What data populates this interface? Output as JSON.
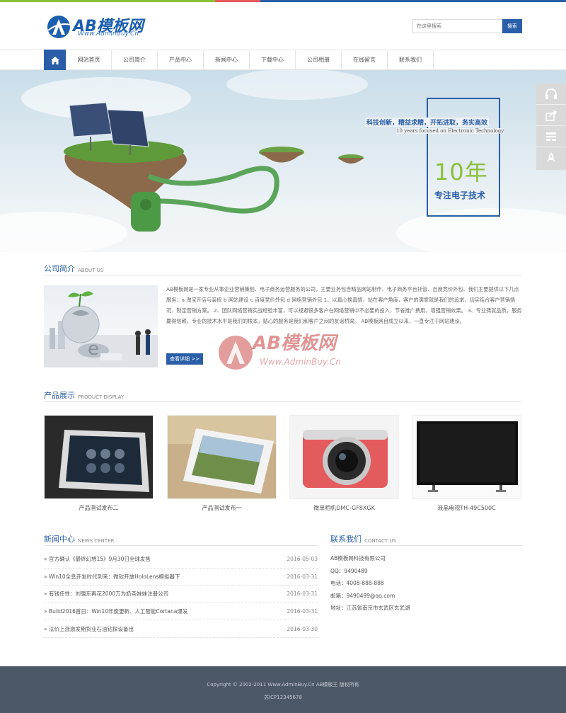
{
  "colors": {
    "primary": "#2a5ea8",
    "accent_green": "#8bbf3a",
    "topbar": [
      "#8bbf3a",
      "#e65a5a",
      "#2a5ea8"
    ],
    "footer_bg": "#4d5867"
  },
  "header": {
    "logo_text": "AB模板网",
    "logo_sub": "Www.AdminBuy.Cn",
    "search_placeholder": "在这里搜索",
    "search_button": "搜索"
  },
  "nav": {
    "home_icon": "home-icon",
    "items": [
      "网站首页",
      "公司简介",
      "产品中心",
      "新闻中心",
      "下载中心",
      "公司相册",
      "在线留言",
      "联系我们"
    ]
  },
  "banner": {
    "slogan": "科技创新，精益求精，开拓进取，务实高效",
    "sub": "10 years focused on Electronic Technology",
    "years": "10年",
    "tagline": "专注电子技术"
  },
  "side_tools": [
    "headset-icon",
    "share-icon",
    "qrcode-icon",
    "rocket-icon"
  ],
  "about": {
    "title": "公司简介",
    "title_en": "ABOUT US",
    "text": "AB模板网是一家专业从事企业营销策划、电子商务运营服务的公司，主要业务包含精品网站制作、电子商务平台托管、百度竞价外包、我们主要提供以下几点服务：a 淘宝开店与装修 b 网站建设 c 百度竞价外包 d 网络营销外包 1、以真心换真情，站在客户角度，客户的满意就是我们的追求，切实结合客户营销情况，制定营销方案。 2、团队网络营销实战经验丰富，可以规避很多客户在网络营销中不必要的投入，节省推广费用，增强营销效果。 3、专业铸就品质，服务赢得信赖，专业的技术水平是我们的根本，贴心的服务是我们和客户之间的友谊桥梁。 AB模板网自成立以来，一直专注于网站建设。",
    "more": "查看详细 >>",
    "watermark": "AB模板网",
    "watermark_sub": "Www.AdminBuy.Cn"
  },
  "products": {
    "title": "产品展示",
    "title_en": "PRODUCT DISPLAY",
    "items": [
      {
        "name": "产品测试发布二"
      },
      {
        "name": "产品测试发布一"
      },
      {
        "name": "微单相机DMC-GF8XGK"
      },
      {
        "name": "液晶电视TH-49C500C"
      }
    ]
  },
  "news": {
    "title": "新闻中心",
    "title_en": "NEWS CENTER",
    "items": [
      {
        "title": "官方确认《最终幻想15》9月30日全球发售",
        "date": "2016-05-03"
      },
      {
        "title": "Win10全息开发时代到来：微软开放HoloLens模拟器下",
        "date": "2016-03-31"
      },
      {
        "title": "有钱任性：刘强东再花2000万为奶茶妹妹注册公司",
        "date": "2016-03-31"
      },
      {
        "title": "Build2016首日：Win10年度更新、人工智能Cortana爆发",
        "date": "2016-03-31"
      },
      {
        "title": "法价上涨激发期货业石油钻探设备出",
        "date": "2016-03-30"
      }
    ]
  },
  "contact": {
    "title": "联系我们",
    "title_en": "CONTACT US",
    "lines": [
      "AB模板网科技有限公司",
      "QQ：9490489",
      "电话：4008-888-888",
      "邮箱：9490489@qq.com",
      "地址：江苏省南京市玄武区玄武湖"
    ]
  },
  "footer": {
    "copyright": "Copyright © 2002-2011 Www.AdminBuy.Cn AB模板王 版权所有",
    "icp": "苏ICP12345678"
  }
}
